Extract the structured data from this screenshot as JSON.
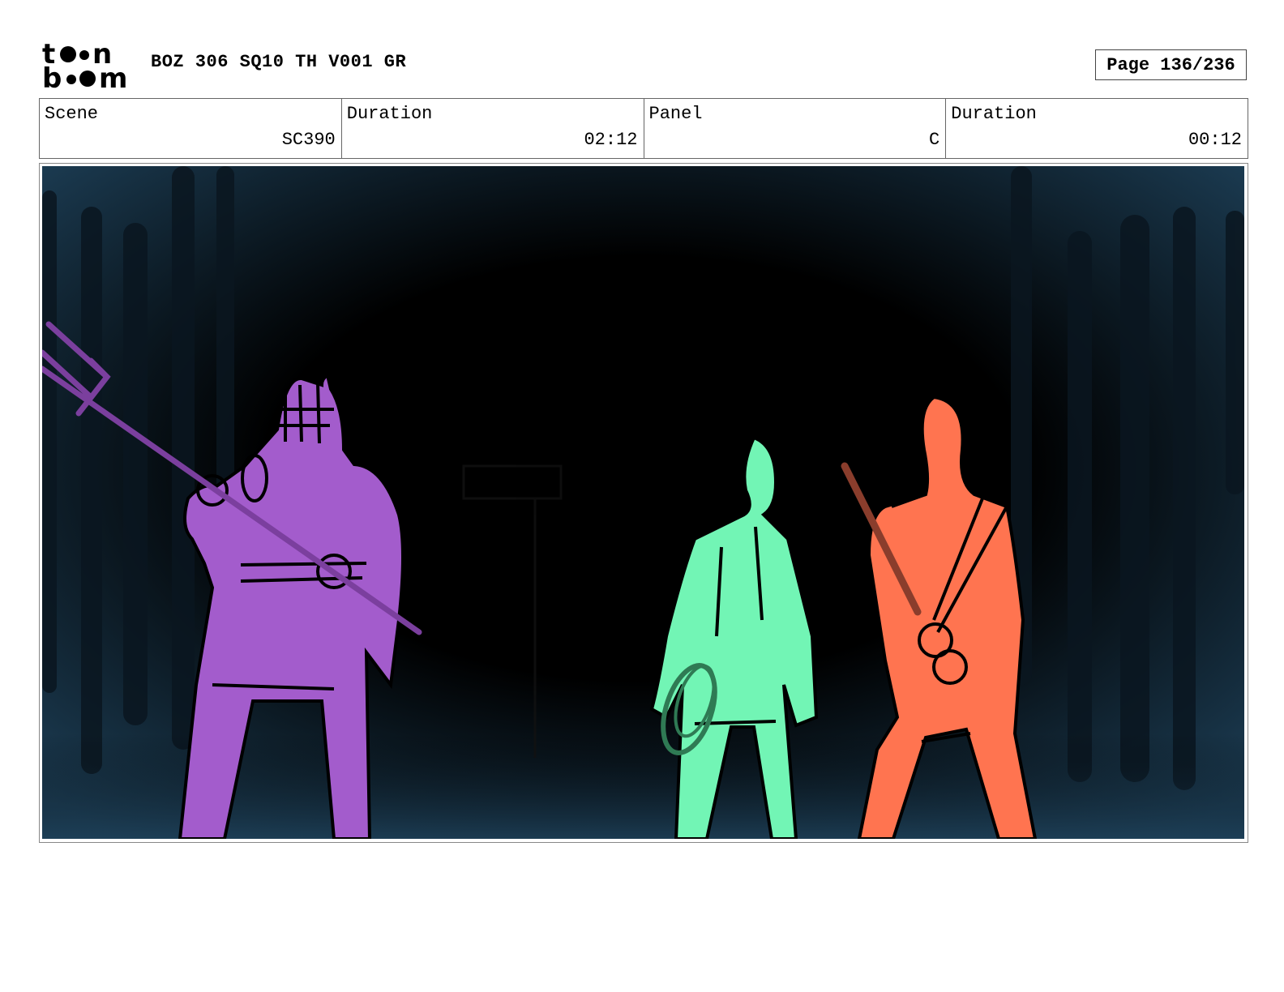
{
  "header": {
    "logo_text": "toon boom",
    "project_title": "BOZ 306 SQ10 TH V001 GR",
    "page_label": "Page 136/236"
  },
  "info": {
    "scene": {
      "label": "Scene",
      "value": "SC390"
    },
    "scene_duration": {
      "label": "Duration",
      "value": "02:12"
    },
    "panel": {
      "label": "Panel",
      "value": "C"
    },
    "panel_duration": {
      "label": "Duration",
      "value": "00:12"
    }
  },
  "panel_art": {
    "colors": {
      "background_dark": "#000000",
      "background_blue": "#1d3f57",
      "figure_left": "#a35ccc",
      "figure_center": "#72f5b5",
      "figure_right": "#ff7450",
      "weapon_purple": "#7b3f9e",
      "staff_brown": "#8a3d2c",
      "rope_green": "#2f7a54"
    }
  }
}
